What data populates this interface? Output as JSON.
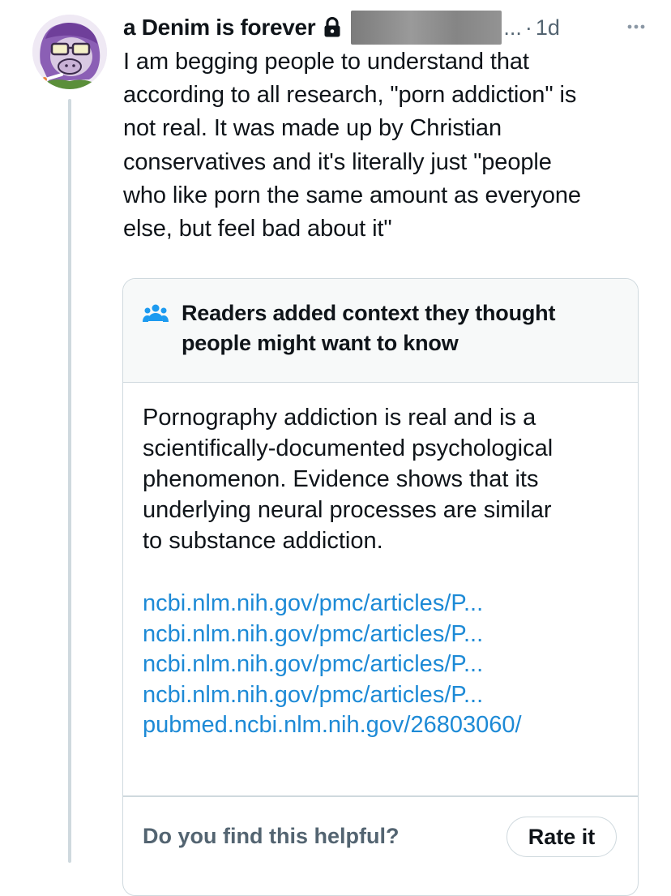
{
  "tweet": {
    "author_name": "a Denim is forever",
    "handle_tail": "...",
    "separator": "·",
    "time": "1d",
    "text": "I am begging people to understand that\naccording to all research, \"porn addiction\" is\nnot real. It was made up by Christian\nconservatives and it's literally just \"people\nwho like porn the same amount as everyone\nelse, but feel bad about it\""
  },
  "note": {
    "title": "Readers added context they thought people might want to know",
    "body": "Pornography addiction is real and is a\nscientifically-documented psychological\nphenomenon. Evidence shows that its\nunderlying neural processes are similar\nto substance addiction.",
    "links": [
      "ncbi.nlm.nih.gov/pmc/articles/P...",
      "ncbi.nlm.nih.gov/pmc/articles/P...",
      "ncbi.nlm.nih.gov/pmc/articles/P...",
      "ncbi.nlm.nih.gov/pmc/articles/P...",
      "pubmed.ncbi.nlm.nih.gov/26803060/"
    ],
    "helpful_prompt": "Do you find this helpful?",
    "rate_label": "Rate it"
  },
  "colors": {
    "text_primary": "#0f1419",
    "text_secondary": "#536471",
    "link": "#1d8ad6",
    "border": "#cfd9de",
    "note_header_bg": "#f7f9f9",
    "avatar_accent": "#8b5fb5"
  },
  "icons": {
    "lock": "lock-icon",
    "more": "more-icon",
    "note": "people-icon"
  }
}
